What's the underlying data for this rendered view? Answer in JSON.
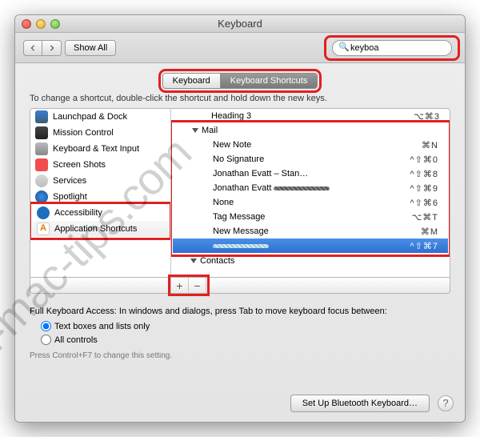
{
  "window": {
    "title": "Keyboard"
  },
  "toolbar": {
    "show_all": "Show All",
    "search_value": "keyboa"
  },
  "tabs": [
    {
      "label": "Keyboard"
    },
    {
      "label": "Keyboard Shortcuts"
    }
  ],
  "instruction": "To change a shortcut, double-click the shortcut and hold down the new keys.",
  "categories": [
    {
      "label": "Launchpad & Dock"
    },
    {
      "label": "Mission Control"
    },
    {
      "label": "Keyboard & Text Input"
    },
    {
      "label": "Screen Shots"
    },
    {
      "label": "Services"
    },
    {
      "label": "Spotlight"
    },
    {
      "label": "Accessibility"
    },
    {
      "label": "Application Shortcuts"
    }
  ],
  "shortcut_rows": [
    {
      "label": "Heading 3",
      "keys": "⌥⌘3",
      "depth": 2
    },
    {
      "label": "Mail",
      "keys": "",
      "depth": 1,
      "expanded": true
    },
    {
      "label": "New Note",
      "keys": "⌘N",
      "depth": 2
    },
    {
      "label": "No Signature",
      "keys": "^⇧⌘0",
      "depth": 2
    },
    {
      "label": "Jonathan Evatt – Stan…",
      "keys": "^⇧⌘8",
      "depth": 2
    },
    {
      "label": "Jonathan Evatt",
      "keys": "^⇧⌘9",
      "depth": 2,
      "scratched": true
    },
    {
      "label": "None",
      "keys": "^⇧⌘6",
      "depth": 2
    },
    {
      "label": "Tag Message",
      "keys": "⌥⌘T",
      "depth": 2
    },
    {
      "label": "New Message",
      "keys": "⌘M",
      "depth": 2
    },
    {
      "label": "",
      "keys": "^⇧⌘7",
      "depth": 2,
      "selected": true,
      "scratched": true
    },
    {
      "label": "Contacts",
      "keys": "",
      "depth": 1,
      "expanded": true
    }
  ],
  "full_access": {
    "heading": "Full Keyboard Access: In windows and dialogs, press Tab to move keyboard focus between:",
    "opt_text": "Text boxes and lists only",
    "opt_all": "All controls",
    "hint": "Press Control+F7 to change this setting."
  },
  "footer": {
    "bluetooth": "Set Up Bluetooth Keyboard…"
  },
  "watermark": "best-mac-tips.com"
}
